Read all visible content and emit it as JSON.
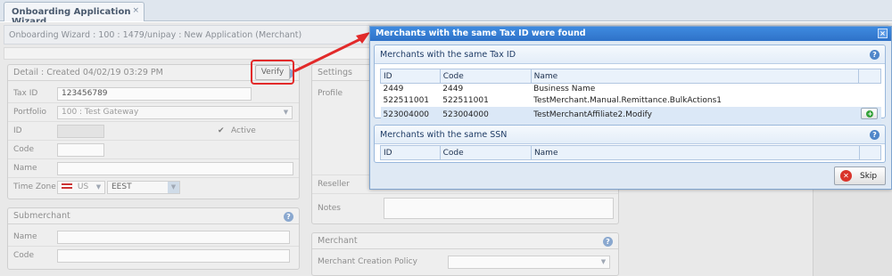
{
  "tab": {
    "title": "Onboarding Application Wizard",
    "close": "×"
  },
  "header": {
    "breadcrumb": "Onboarding Wizard : 100 : 1479/unipay : New Application (Merchant)"
  },
  "detail": {
    "title": "Detail : Created 04/02/19 03:29 PM",
    "tax_id_label": "Tax ID",
    "tax_id_value": "123456789",
    "verify_label": "Verify",
    "portfolio_label": "Portfolio",
    "portfolio_value": "100 : Test Gateway",
    "id_label": "ID",
    "active_label": "Active",
    "code_label": "Code",
    "name_label": "Name",
    "timezone_label": "Time Zone",
    "country_value": "US",
    "timezone_value": "EEST"
  },
  "submerchant": {
    "title": "Submerchant",
    "name_label": "Name",
    "code_label": "Code"
  },
  "settings": {
    "title": "Settings",
    "profile_label": "Profile",
    "reseller_label": "Reseller",
    "notes_label": "Notes"
  },
  "merchant": {
    "title": "Merchant",
    "policy_label": "Merchant Creation Policy"
  },
  "modal": {
    "title": "Merchants with the same Tax ID were found",
    "close": "×",
    "tax_panel": {
      "title": "Merchants with the same Tax ID",
      "columns": [
        "ID",
        "Code",
        "Name"
      ],
      "rows": [
        {
          "id": "2449",
          "code": "2449",
          "name": "Business Name"
        },
        {
          "id": "522511001",
          "code": "522511001",
          "name": "TestMerchant.Manual.Remittance.BulkActions1"
        },
        {
          "id": "523004000",
          "code": "523004000",
          "name": "TestMerchantAffiliate2.Modify"
        }
      ]
    },
    "ssn_panel": {
      "title": "Merchants with the same SSN",
      "columns": [
        "ID",
        "Code",
        "Name"
      ]
    },
    "skip_label": "Skip"
  },
  "colors": {
    "accent": "#2f72c8",
    "highlight": "#e22a2a",
    "add": "#35a23a",
    "skip": "#d9342b"
  }
}
